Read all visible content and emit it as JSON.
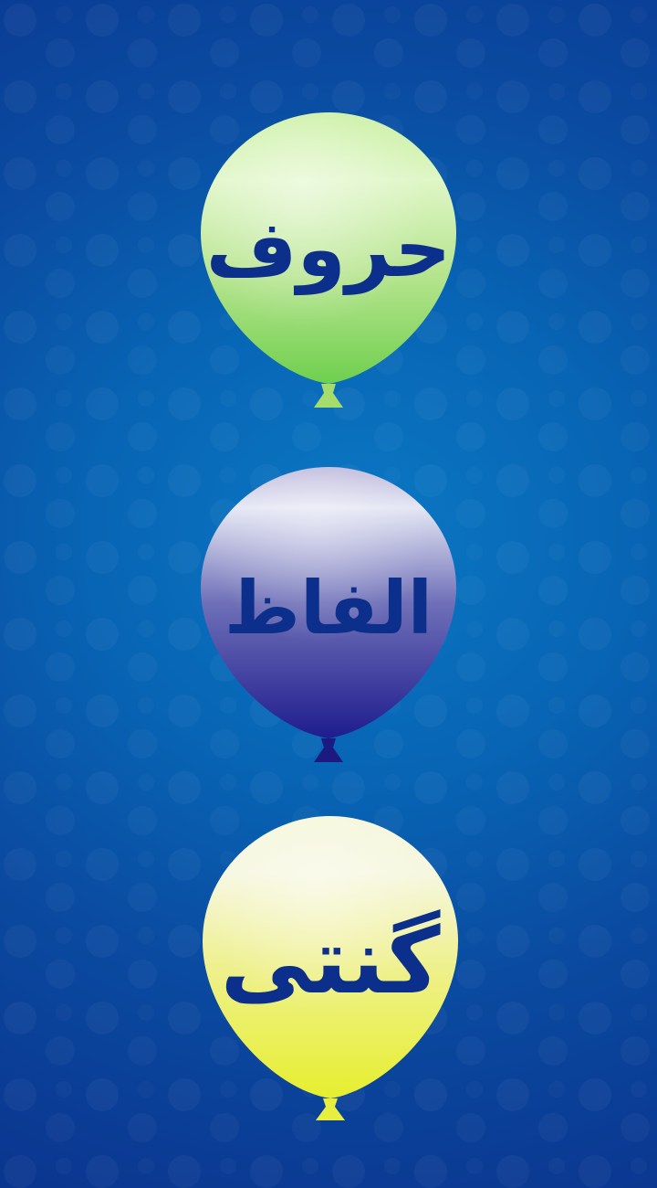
{
  "menu": {
    "items": [
      {
        "label": "حروف",
        "color": "#8cd86a"
      },
      {
        "label": "الفاظ",
        "color": "#2b2a96"
      },
      {
        "label": "گنتی",
        "color": "#eaf03a"
      }
    ]
  },
  "colors": {
    "background_center": "#0a78c4",
    "background_edge": "#0b3690",
    "label_text": "#0b2f8a"
  }
}
